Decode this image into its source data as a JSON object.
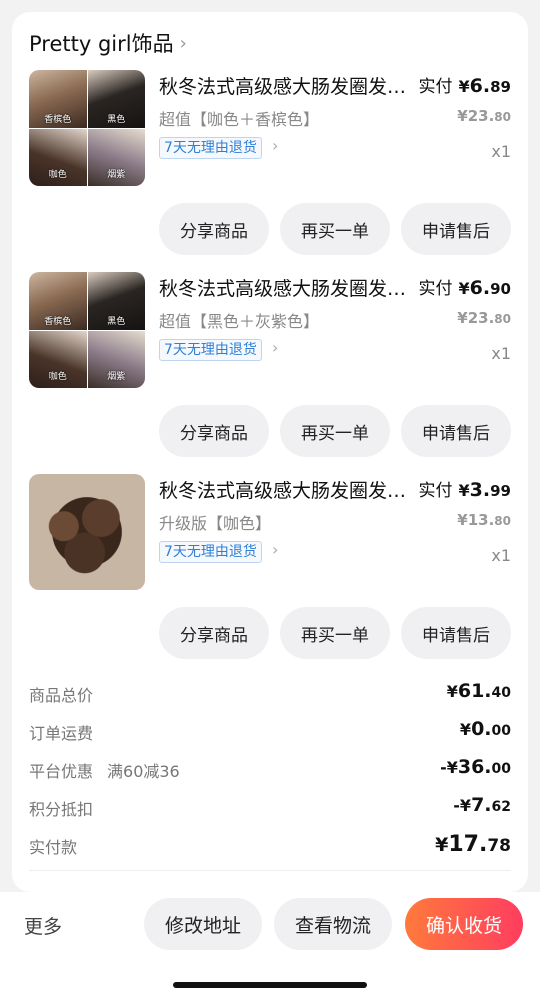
{
  "shop": {
    "name": "Pretty girl饰品"
  },
  "items": [
    {
      "title": "秋冬法式高级感大肠发圈发饰高颅顶发圈头饰",
      "variant": "超值【咖色＋香槟色】",
      "return_tag": "7天无理由退货",
      "paid_label": "实付",
      "paid_symbol": "¥",
      "paid_int": "6.",
      "paid_dec": "89",
      "orig_int": "¥23.",
      "orig_dec": "80",
      "qty": "x1",
      "thumb_labels": [
        "香槟色",
        "黑色",
        "咖色",
        "烟紫"
      ],
      "buttons": [
        "分享商品",
        "再买一单",
        "申请售后"
      ]
    },
    {
      "title": "秋冬法式高级感大肠发圈发饰高颅顶发圈头饰",
      "variant": "超值【黑色＋灰紫色】",
      "return_tag": "7天无理由退货",
      "paid_label": "实付",
      "paid_symbol": "¥",
      "paid_int": "6.",
      "paid_dec": "90",
      "orig_int": "¥23.",
      "orig_dec": "80",
      "qty": "x1",
      "thumb_labels": [
        "香槟色",
        "黑色",
        "咖色",
        "烟紫"
      ],
      "buttons": [
        "分享商品",
        "再买一单",
        "申请售后"
      ]
    },
    {
      "title": "秋冬法式高级感大肠发圈发饰高颅顶发圈头饰",
      "variant": "升级版【咖色】",
      "return_tag": "7天无理由退货",
      "paid_label": "实付",
      "paid_symbol": "¥",
      "paid_int": "3.",
      "paid_dec": "99",
      "orig_int": "¥13.",
      "orig_dec": "80",
      "qty": "x1",
      "buttons": [
        "分享商品",
        "再买一单",
        "申请售后"
      ]
    }
  ],
  "summary": {
    "subtotal": {
      "label": "商品总价",
      "sym": "¥",
      "int": "61.",
      "dec": "40"
    },
    "shipping": {
      "label": "订单运费",
      "sym": "¥",
      "int": "0.",
      "dec": "00"
    },
    "discount": {
      "label": "平台优惠",
      "extra": "满60减36",
      "sym": "-¥",
      "int": "36.",
      "dec": "00"
    },
    "points": {
      "label": "积分抵扣",
      "sym": "-¥",
      "int": "7.",
      "dec": "62"
    },
    "total": {
      "label": "实付款",
      "sym": "¥",
      "int": "17.",
      "dec": "78"
    }
  },
  "bottom": {
    "more": "更多",
    "change_address": "修改地址",
    "view_logistics": "查看物流",
    "confirm_receipt": "确认收货"
  },
  "colors": {
    "accent_start": "#ff7a3c",
    "accent_end": "#ff3d5f",
    "tag_blue": "#2f7fd6"
  }
}
